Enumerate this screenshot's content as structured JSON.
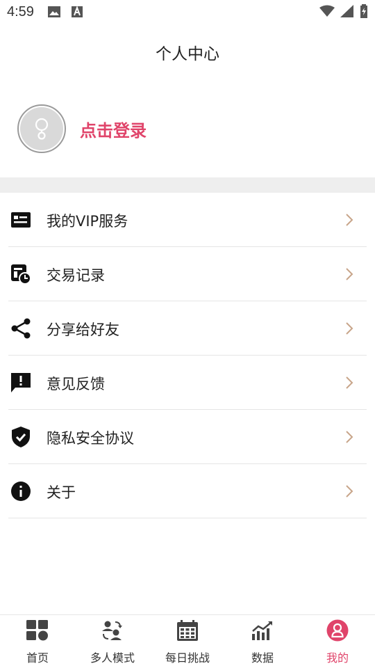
{
  "status_bar": {
    "time": "4:59",
    "icons": [
      "image-icon",
      "keyboard-a-icon",
      "wifi-icon",
      "signal-icon",
      "battery-icon"
    ]
  },
  "header": {
    "title": "个人中心"
  },
  "profile": {
    "login_label": "点击登录",
    "avatar_icon": "user-placeholder-icon"
  },
  "menu": {
    "items": [
      {
        "label": "我的VIP服务",
        "icon": "vip-card-icon"
      },
      {
        "label": "交易记录",
        "icon": "transaction-history-icon"
      },
      {
        "label": "分享给好友",
        "icon": "share-icon"
      },
      {
        "label": "意见反馈",
        "icon": "feedback-icon"
      },
      {
        "label": "隐私安全协议",
        "icon": "shield-check-icon"
      },
      {
        "label": "关于",
        "icon": "info-icon"
      }
    ]
  },
  "bottom_nav": {
    "items": [
      {
        "label": "首页",
        "icon": "home-grid-icon",
        "active": false
      },
      {
        "label": "多人模式",
        "icon": "multiplayer-icon",
        "active": false
      },
      {
        "label": "每日挑战",
        "icon": "calendar-icon",
        "active": false
      },
      {
        "label": "数据",
        "icon": "chart-icon",
        "active": false
      },
      {
        "label": "我的",
        "icon": "profile-icon",
        "active": true
      }
    ]
  },
  "colors": {
    "accent": "#e0446a",
    "arrow": "#c8a58a",
    "band": "#eeeeee"
  }
}
